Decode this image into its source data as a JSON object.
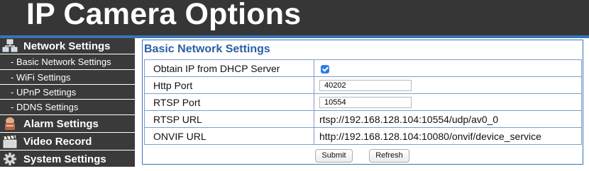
{
  "header": {
    "title": "IP Camera Options"
  },
  "sidebar": {
    "items": [
      {
        "label": "Network Settings",
        "icon": "network-icon"
      },
      {
        "label": "- Basic Network Settings"
      },
      {
        "label": "- WiFi Settings"
      },
      {
        "label": "- UPnP Settings"
      },
      {
        "label": "- DDNS Settings"
      },
      {
        "label": "Alarm Settings",
        "icon": "alarm-icon"
      },
      {
        "label": "Video Record",
        "icon": "film-icon"
      },
      {
        "label": "System Settings",
        "icon": "gear-icon"
      }
    ]
  },
  "main": {
    "section_title": "Basic Network Settings",
    "rows": {
      "dhcp": {
        "label": "Obtain IP from DHCP Server",
        "checked": true
      },
      "http_port": {
        "label": "Http Port",
        "value": "40202"
      },
      "rtsp_port": {
        "label": "RTSP Port",
        "value": "10554"
      },
      "rtsp_url": {
        "label": "RTSP URL",
        "value": "rtsp://192.168.128.104:10554/udp/av0_0"
      },
      "onvif_url": {
        "label": "ONVIF URL",
        "value": "http://192.168.128.104:10080/onvif/device_service"
      }
    },
    "buttons": {
      "submit": "Submit",
      "refresh": "Refresh"
    }
  },
  "colors": {
    "accent": "#3a73b5",
    "header_bg": "#363636",
    "nav_bg": "#3a3a3a",
    "title_blue": "#2a5fa4",
    "checkbox": "#2e7be5"
  }
}
